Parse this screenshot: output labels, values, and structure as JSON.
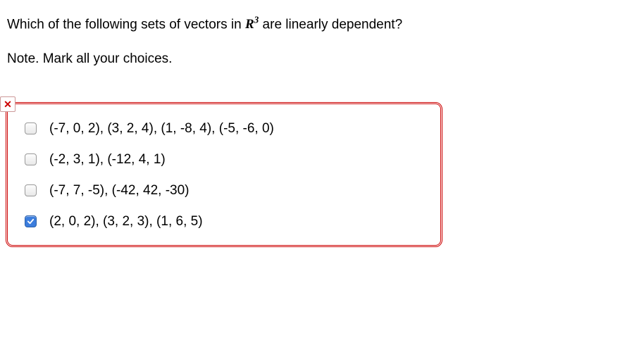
{
  "question": {
    "line1_pre": "Which of the following sets of vectors in ",
    "var_base": "R",
    "var_exp": "3",
    "line1_post": " are linearly dependent?",
    "note": "Note. Mark all your choices."
  },
  "status": {
    "icon": "✕",
    "semantic": "incorrect"
  },
  "options": [
    {
      "label": "(-7, 0, 2), (3, 2, 4), (1, -8, 4), (-5, -6, 0)",
      "checked": false
    },
    {
      "label": "(-2, 3, 1), (-12, 4, 1)",
      "checked": false
    },
    {
      "label": "(-7, 7, -5), (-42, 42, -30)",
      "checked": false
    },
    {
      "label": "(2, 0, 2), (3, 2, 3), (1, 6, 5)",
      "checked": true
    }
  ]
}
